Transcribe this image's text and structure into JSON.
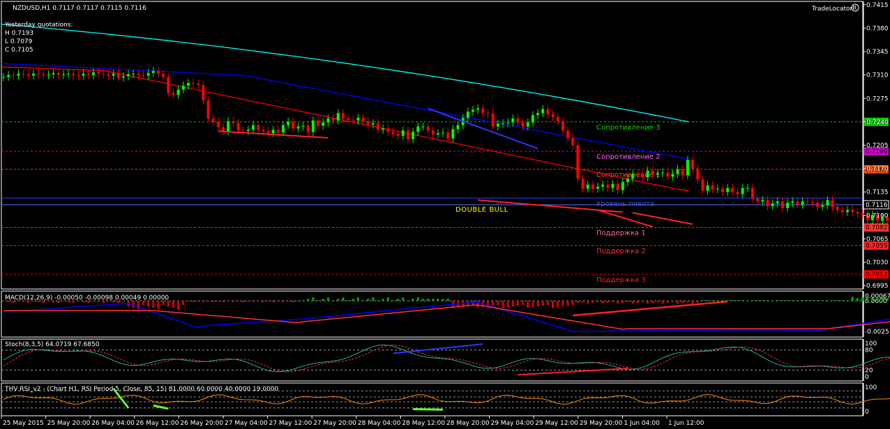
{
  "header": {
    "symbol": "NZDUSD,H1  0.7117 0.7117 0.7115 0.7116",
    "yesterday_title": "Yesterday quotations:",
    "yesterday_h": "H 0.7193",
    "yesterday_l": "L 0.7079",
    "yesterday_c": "C 0.7105",
    "brand": "TradeLocator"
  },
  "colors": {
    "bull": "#00ff00",
    "bear": "#ff0000",
    "ma_fast": "#ff0000",
    "ma_mid": "#0000ff",
    "ma_slow": "#00ffff",
    "grid": "#444444"
  },
  "chart_data": [
    {
      "type": "candlestick",
      "title": "NZDUSD,H1",
      "ylim": [
        0.699,
        0.742
      ],
      "y_ticks": [
        "0.7415",
        "0.7380",
        "0.7345",
        "0.7310",
        "0.7275",
        "0.7240",
        "0.7205",
        "0.7170",
        "0.7135",
        "0.7100",
        "0.7065",
        "0.7030",
        "0.6995"
      ],
      "x_ticks": [
        "25 May 2015",
        "25 May 20:00",
        "26 May 04:00",
        "26 May 12:00",
        "26 May 20:00",
        "27 May 04:00",
        "27 May 12:00",
        "27 May 20:00",
        "28 May 04:00",
        "28 May 12:00",
        "28 May 20:00",
        "29 May 04:00",
        "29 May 12:00",
        "29 May 20:00",
        "1 Jun 04:00",
        "1 Jun 12:00"
      ],
      "close_series": [
        0.7307,
        0.731,
        0.7309,
        0.7312,
        0.7311,
        0.7309,
        0.7312,
        0.7311,
        0.731,
        0.7311,
        0.7313,
        0.731,
        0.7311,
        0.7312,
        0.731,
        0.7309,
        0.7312,
        0.731,
        0.7314,
        0.7312,
        0.7311,
        0.7309,
        0.7312,
        0.7306,
        0.7308,
        0.7311,
        0.7312,
        0.731,
        0.7309,
        0.7313,
        0.7316,
        0.7312,
        0.7307,
        0.7283,
        0.728,
        0.7288,
        0.7294,
        0.7298,
        0.7297,
        0.7295,
        0.7272,
        0.7245,
        0.724,
        0.7232,
        0.7226,
        0.7241,
        0.7238,
        0.7227,
        0.7226,
        0.7228,
        0.7235,
        0.7228,
        0.7226,
        0.7223,
        0.7228,
        0.7224,
        0.7235,
        0.724,
        0.723,
        0.7233,
        0.7234,
        0.7225,
        0.7242,
        0.7234,
        0.7239,
        0.7245,
        0.7242,
        0.7253,
        0.7245,
        0.7243,
        0.7242,
        0.7246,
        0.7241,
        0.7236,
        0.7238,
        0.7228,
        0.723,
        0.7225,
        0.7222,
        0.7219,
        0.7227,
        0.7214,
        0.7225,
        0.7233,
        0.7233,
        0.7227,
        0.7221,
        0.7223,
        0.7224,
        0.7215,
        0.7229,
        0.7235,
        0.7246,
        0.7255,
        0.7258,
        0.726,
        0.7253,
        0.7252,
        0.7233,
        0.7237,
        0.7238,
        0.7239,
        0.7245,
        0.7239,
        0.7233,
        0.7239,
        0.725,
        0.7253,
        0.7259,
        0.7251,
        0.7247,
        0.7241,
        0.7227,
        0.7216,
        0.7205,
        0.7155,
        0.714,
        0.7146,
        0.714,
        0.7143,
        0.7146,
        0.7141,
        0.7147,
        0.7138,
        0.715,
        0.7155,
        0.7162,
        0.7161,
        0.7157,
        0.7167,
        0.7161,
        0.7163,
        0.7164,
        0.7158,
        0.7162,
        0.7169,
        0.716,
        0.7183,
        0.717,
        0.7154,
        0.7137,
        0.7145,
        0.7139,
        0.714,
        0.7135,
        0.7141,
        0.7135,
        0.7132,
        0.7141,
        0.7141,
        0.7125,
        0.7121,
        0.7123,
        0.7114,
        0.7118,
        0.7121,
        0.7111,
        0.7119,
        0.7121,
        0.7116,
        0.7121,
        0.712,
        0.7119,
        0.7113,
        0.7115,
        0.7123,
        0.7113,
        0.7108,
        0.7105,
        0.7108,
        0.7105,
        0.7103,
        0.7101,
        0.7093,
        0.7101,
        0.7092,
        0.7097,
        0.7092,
        0.709,
        0.7091,
        0.7089,
        0.7094,
        0.7097,
        0.7093,
        0.7097,
        0.7098,
        0.7103,
        0.7104,
        0.7099,
        0.7101,
        0.7109,
        0.7115,
        0.7112,
        0.7114,
        0.7116
      ],
      "moving_averages": [
        {
          "color": "#ff0000",
          "from": 0.7322,
          "to": 0.7137
        },
        {
          "color": "#0000ff",
          "from": 0.7327,
          "to": 0.7184
        },
        {
          "color": "#00ffff",
          "from": 0.7386,
          "to": 0.724
        }
      ],
      "levels": [
        {
          "name": "Сопротивление 3",
          "value": 0.724,
          "price_label": "0.7240",
          "color": "#00cc00",
          "label_color": "#00dd00",
          "dash": true
        },
        {
          "name": "Сопротивление 2",
          "value": 0.7196,
          "price_label": "0.7196",
          "color": "#cc00cc",
          "label_color": "#ff66ff",
          "dash": true
        },
        {
          "name": "Сопротивление 1",
          "value": 0.7169,
          "price_label": "0.7169",
          "color": "#ff4400",
          "label_color": "#ff5522",
          "dash": true
        },
        {
          "name": "Уровень пивота",
          "value": 0.7126,
          "price_label": "",
          "color": "#2244ff",
          "label_color": "#3355ff",
          "dash": false
        },
        {
          "name": "",
          "value": 0.7116,
          "price_label": "0.7116",
          "color": "#5577ff",
          "label_color": "#ffffff",
          "dash": false
        },
        {
          "name": "Поддержка 1",
          "value": 0.7082,
          "price_label": "0.7082",
          "color": "#ff3333",
          "label_color": "#ff66aa",
          "dash": true
        },
        {
          "name": "Поддержка 2",
          "value": 0.7055,
          "price_label": "0.7055",
          "color": "#ff2222",
          "label_color": "#ff3333",
          "dash": true
        },
        {
          "name": "Поддержка 3",
          "value": 0.7012,
          "price_label": "0.7012",
          "color": "#ff0000",
          "label_color": "#ff2222",
          "dash": true
        }
      ],
      "annotation": "DOUBLE BULL",
      "trendlines": [
        {
          "color": "#ff2222",
          "from": [
            43,
            0.7226
          ],
          "to": [
            65,
            0.7216
          ]
        },
        {
          "color": "#3333ff",
          "from": [
            85,
            0.726
          ],
          "to": [
            107,
            0.72
          ]
        },
        {
          "color": "#ff2222",
          "from": [
            95,
            0.7123
          ],
          "to": [
            124,
            0.7105
          ]
        },
        {
          "color": "#ff2222",
          "from": [
            119,
            0.7108
          ],
          "to": [
            130,
            0.7083
          ]
        },
        {
          "color": "#ff2222",
          "from": [
            126,
            0.7104
          ],
          "to": [
            138,
            0.7087
          ]
        }
      ]
    },
    {
      "type": "histogram",
      "title": "MACD(12,26,9) -0.00050 -0.00098 0.00049 0.00000",
      "y_ticks": [
        "0.00067",
        "0.0000",
        "-0.00251"
      ]
    },
    {
      "type": "line",
      "title": "Stoch(8,3,5) 64.0719 67.6850",
      "y_ticks": [
        "100",
        "80",
        "20",
        "0"
      ]
    },
    {
      "type": "line",
      "title": "THV RSI_v2 - (Chart H1,  RSI Period 5,  Close,  85,  15)  81.0000 60.0000 40.0000 19.0000",
      "y_ticks": [
        "100",
        "0"
      ]
    }
  ]
}
